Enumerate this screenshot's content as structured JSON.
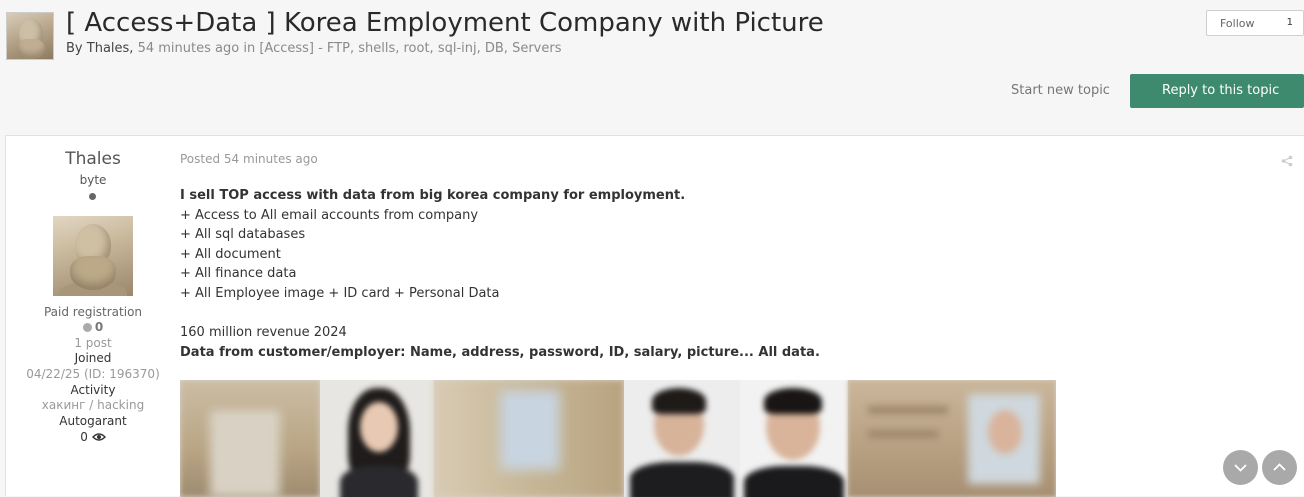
{
  "topic": {
    "title": "[ Access+Data ] Korea Employment Company with Picture",
    "meta_by": "By",
    "author": "Thales",
    "comma": ",",
    "time_ago": "54 minutes ago",
    "in_word": "in",
    "forum": "[Access] - FTP, shells, root, sql-inj, DB, Servers"
  },
  "follow": {
    "label": "Follow",
    "count": "1"
  },
  "actions": {
    "start_new_topic": "Start new topic",
    "reply": "Reply to this topic"
  },
  "author_panel": {
    "name": "Thales",
    "rank": "byte",
    "group": "Paid registration",
    "reputation": "0",
    "posts": "1 post",
    "joined_label": "Joined",
    "joined_value": "04/22/25 (ID: 196370)",
    "activity_label": "Activity",
    "activity_value": "хакинг / hacking",
    "autogarant_label": "Autogarant",
    "autogarant_value": "0"
  },
  "post": {
    "posted": "Posted 54 minutes ago",
    "lines": [
      "I sell TOP access with data from big korea company for employment.",
      "+ Access to All email accounts from company",
      "+ All sql databases",
      "+ All document",
      "+ All finance data",
      "+ All Employee image + ID card + Personal Data",
      "160 million revenue 2024",
      "Data from customer/employer: Name, address, password, ID, salary, picture... All data."
    ]
  },
  "colors": {
    "accent": "#3d8a6e",
    "background": "#f6f6f6"
  },
  "icons": [
    "share-icon",
    "chevron-down-icon",
    "chevron-up-icon",
    "status-dot-icon",
    "eye-icon"
  ]
}
